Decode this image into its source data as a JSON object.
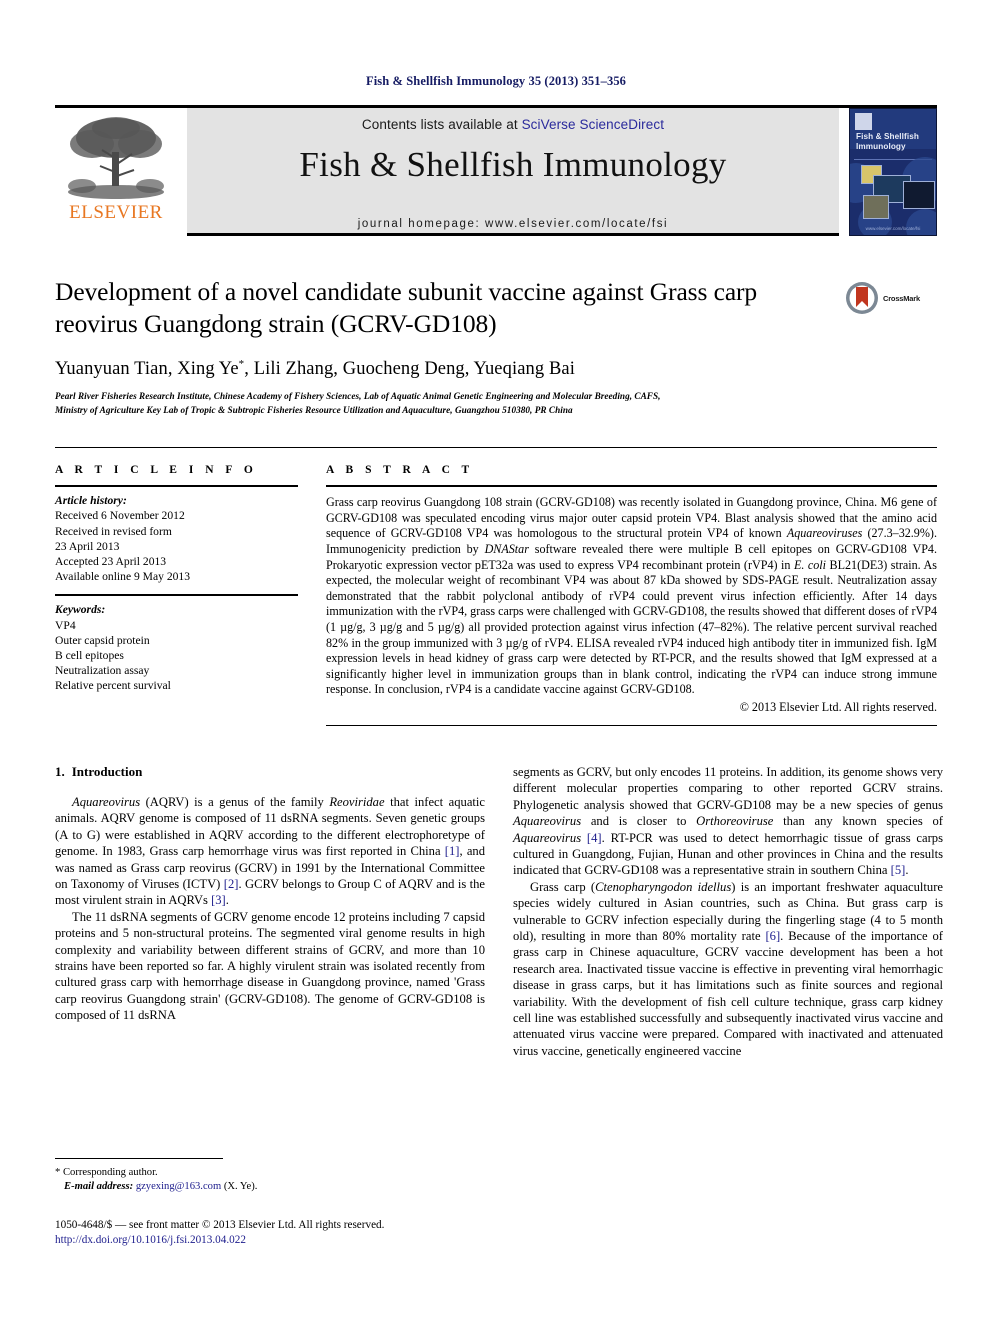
{
  "running_head": "Fish & Shellfish Immunology 35 (2013) 351–356",
  "masthead": {
    "publisher_name": "ELSEVIER",
    "publisher_logo_icon": "elsevier-tree-icon",
    "contents_prefix": "Contents lists available at ",
    "contents_link": "SciVerse ScienceDirect",
    "journal_title": "Fish & Shellfish Immunology",
    "homepage_line": "journal homepage: www.elsevier.com/locate/fsi",
    "cover": {
      "title_line1": "Fish & Shellfish",
      "title_line2": "Immunology",
      "footer_text": "www.elsevier.com/locate/fsi"
    }
  },
  "article": {
    "title": "Development of a novel candidate subunit vaccine against Grass carp reovirus Guangdong strain (GCRV-GD108)",
    "crossmark_label": "CrossMark",
    "crossmark_icon": "crossmark-icon",
    "authors": "Yuanyuan Tian, Xing Ye",
    "authors_star": "*",
    "authors_rest": ", Lili Zhang, Guocheng Deng, Yueqiang Bai",
    "affiliation_line1": "Pearl River Fisheries Research Institute, Chinese Academy of Fishery Sciences, Lab of Aquatic Animal Genetic Engineering and Molecular Breeding, CAFS,",
    "affiliation_line2": "Ministry of Agriculture Key Lab of Tropic & Subtropic Fisheries Resource Utilization and Aquaculture, Guangzhou 510380, PR China"
  },
  "article_info": {
    "heading": "A R T I C L E   I N F O",
    "history_label": "Article history:",
    "history": [
      "Received 6 November 2012",
      "Received in revised form",
      "23 April 2013",
      "Accepted 23 April 2013",
      "Available online 9 May 2013"
    ],
    "keywords_label": "Keywords:",
    "keywords": [
      "VP4",
      "Outer capsid protein",
      "B cell epitopes",
      "Neutralization assay",
      "Relative percent survival"
    ]
  },
  "abstract": {
    "heading": "A B S T R A C T",
    "text": "Grass carp reovirus Guangdong 108 strain (GCRV-GD108) was recently isolated in Guangdong province, China. M6 gene of GCRV-GD108 was speculated encoding virus major outer capsid protein VP4. Blast analysis showed that the amino acid sequence of GCRV-GD108 VP4 was homologous to the structural protein VP4 of known Aquareoviruses (27.3–32.9%). Immunogenicity prediction by DNAStar software revealed there were multiple B cell epitopes on GCRV-GD108 VP4. Prokaryotic expression vector pET32a was used to express VP4 recombinant protein (rVP4) in E. coli BL21(DE3) strain. As expected, the molecular weight of recombinant VP4 was about 87 kDa showed by SDS-PAGE result. Neutralization assay demonstrated that the rabbit polyclonal antibody of rVP4 could prevent virus infection efficiently. After 14 days immunization with the rVP4, grass carps were challenged with GCRV-GD108, the results showed that different doses of rVP4 (1 µg/g, 3 µg/g and 5 µg/g) all provided protection against virus infection (47–82%). The relative percent survival reached 82% in the group immunized with 3 µg/g of rVP4. ELISA revealed rVP4 induced high antibody titer in immunized fish. IgM expression levels in head kidney of grass carp were detected by RT-PCR, and the results showed that IgM expressed at a significantly higher level in immunization groups than in blank control, indicating the rVP4 can induce strong immune response. In conclusion, rVP4 is a candidate vaccine against GCRV-GD108.",
    "copyright": "© 2013 Elsevier Ltd. All rights reserved."
  },
  "introduction": {
    "number": "1.",
    "heading": "Introduction",
    "left_paragraphs": [
      "Aquareovirus (AQRV) is a genus of the family Reoviridae that infect aquatic animals. AQRV genome is composed of 11 dsRNA segments. Seven genetic groups (A to G) were established in AQRV according to the different electrophoretype of genome. In 1983, Grass carp hemorrhage virus was first reported in China [1], and was named as Grass carp reovirus (GCRV) in 1991 by the International Committee on Taxonomy of Viruses (ICTV) [2]. GCRV belongs to Group C of AQRV and is the most virulent strain in AQRVs [3].",
      "The 11 dsRNA segments of GCRV genome encode 12 proteins including 7 capsid proteins and 5 non-structural proteins. The segmented viral genome results in high complexity and variability between different strains of GCRV, and more than 10 strains have been reported so far. A highly virulent strain was isolated recently from cultured grass carp with hemorrhage disease in Guangdong province, named 'Grass carp reovirus Guangdong strain' (GCRV-GD108). The genome of GCRV-GD108 is composed of 11 dsRNA"
    ],
    "right_paragraphs": [
      "segments as GCRV, but only encodes 11 proteins. In addition, its genome shows very different molecular properties comparing to other reported GCRV strains. Phylogenetic analysis showed that GCRV-GD108 may be a new species of genus Aquareovirus and is closer to Orthoreoviruse than any known species of Aquareovirus [4]. RT-PCR was used to detect hemorrhagic tissue of grass carps cultured in Guangdong, Fujian, Hunan and other provinces in China and the results indicated that GCRV-GD108 was a representative strain in southern China [5].",
      "Grass carp (Ctenopharyngodon idellus) is an important freshwater aquaculture species widely cultured in Asian countries, such as China. But grass carp is vulnerable to GCRV infection especially during the fingerling stage (4 to 5 month old), resulting in more than 80% mortality rate [6]. Because of the importance of grass carp in Chinese aquaculture, GCRV vaccine development has been a hot research area. Inactivated tissue vaccine is effective in preventing viral hemorrhagic disease in grass carps, but it has limitations such as finite sources and regional variability. With the development of fish cell culture technique, grass carp kidney cell line was established successfully and subsequently inactivated virus vaccine and attenuated virus vaccine were prepared. Compared with inactivated and attenuated virus vaccine, genetically engineered vaccine"
    ]
  },
  "footnote": {
    "star": "*",
    "corresponding": "Corresponding author.",
    "email_label": "E-mail address:",
    "email": "gzyexing@163.com",
    "email_suffix": "(X. Ye)."
  },
  "colophon": {
    "line1": "1050-4648/$ — see front matter © 2013 Elsevier Ltd. All rights reserved.",
    "doi": "http://dx.doi.org/10.1016/j.fsi.2013.04.022"
  }
}
